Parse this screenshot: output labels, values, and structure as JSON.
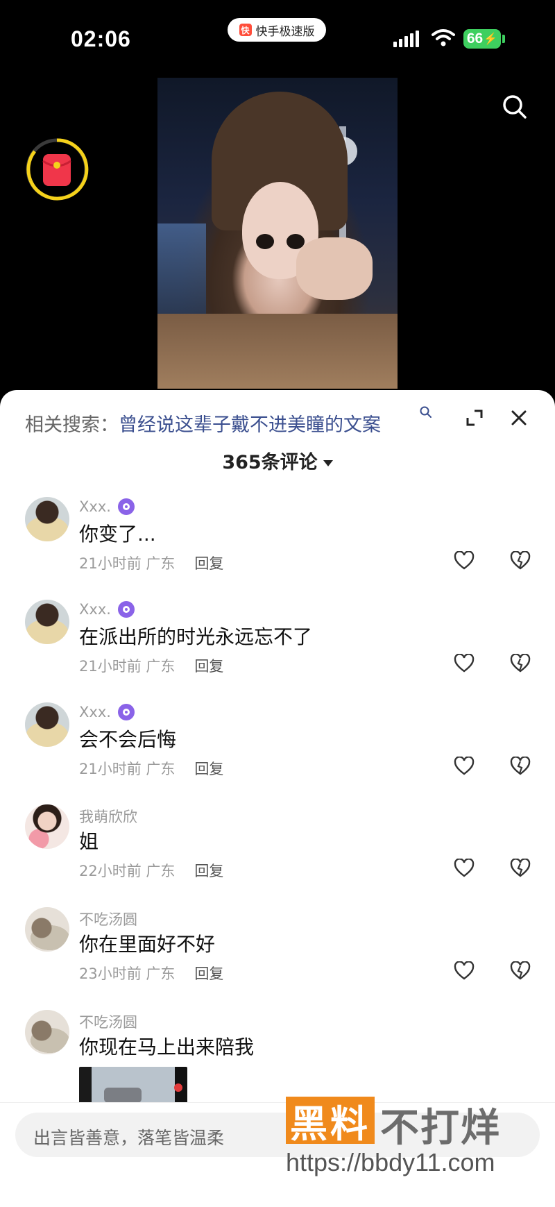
{
  "status": {
    "time": "02:06",
    "app_name": "快手极速版",
    "battery": "66"
  },
  "related": {
    "label": "相关搜索：",
    "query": "曾经说这辈子戴不进美瞳的文案"
  },
  "comments_header": {
    "count_label": "365条评论"
  },
  "comments": [
    {
      "user": "Xxx.",
      "text": "你变了...",
      "time": "21小时前",
      "region": "广东",
      "reply": "回复"
    },
    {
      "user": "Xxx.",
      "text": "在派出所的时光永远忘不了",
      "time": "21小时前",
      "region": "广东",
      "reply": "回复"
    },
    {
      "user": "Xxx.",
      "text": "会不会后悔",
      "time": "21小时前",
      "region": "广东",
      "reply": "回复"
    },
    {
      "user": "我萌欣欣",
      "text": "姐",
      "time": "22小时前",
      "region": "广东",
      "reply": "回复"
    },
    {
      "user": "不吃汤圆",
      "text": "你在里面好不好",
      "time": "23小时前",
      "region": "广东",
      "reply": "回复"
    },
    {
      "user": "不吃汤圆",
      "text": "你现在马上出来陪我"
    }
  ],
  "input": {
    "placeholder": "出言皆善意，落笔皆温柔"
  },
  "watermark": {
    "brand_a": "黑料",
    "brand_b": "不打烊",
    "url": "https://bbdy11.com"
  },
  "icons": [
    "search-icon",
    "red-packet-icon",
    "expand-icon",
    "close-icon",
    "verified-badge-icon",
    "like-icon",
    "dislike-icon"
  ],
  "colors": {
    "accent_query": "#3b4f8f",
    "badge": "#8a63e8",
    "battery": "#3ecf5f",
    "watermark": "#f08a1c"
  }
}
